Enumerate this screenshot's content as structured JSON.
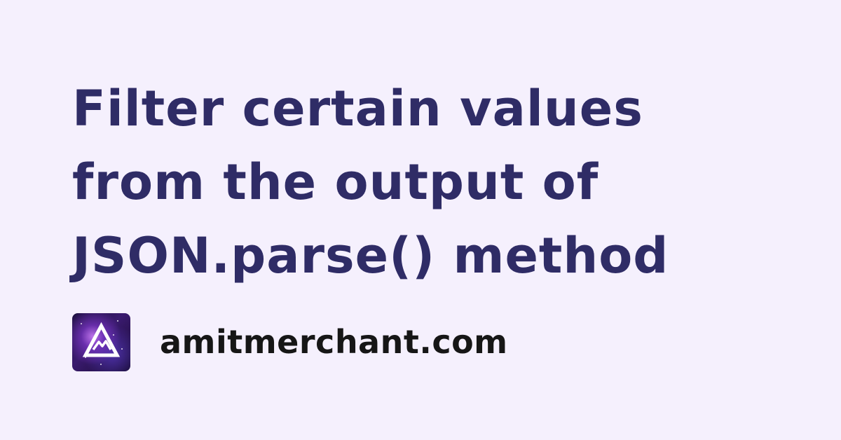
{
  "title_lines": [
    "Filter certain values",
    "from the output of",
    "JSON.parse() method"
  ],
  "site": {
    "name": "amitmerchant.com",
    "logo_icon": "mountain-triangle-logo-icon"
  },
  "colors": {
    "background": "#f5f0fd",
    "title": "#2f2c66",
    "site_text": "#161616"
  }
}
